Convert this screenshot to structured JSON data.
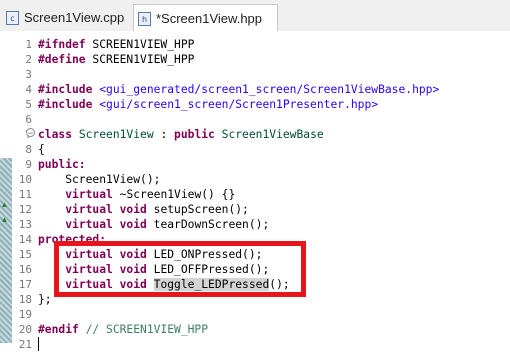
{
  "tabs": [
    {
      "label": "Screen1View.cpp",
      "icon": "cpp-file-icon",
      "icon_glyph": "c",
      "active": false
    },
    {
      "label": "*Screen1View.hpp",
      "icon": "header-file-icon",
      "icon_glyph": "h",
      "active": true
    }
  ],
  "gutter": {
    "line_numbers": [
      "1",
      "2",
      "3",
      "4",
      "5",
      "6",
      "7",
      "8",
      "9",
      "10",
      "11",
      "12",
      "13",
      "14",
      "15",
      "16",
      "17",
      "18",
      "19",
      "20",
      "21"
    ]
  },
  "code": {
    "l1a": "#ifndef ",
    "l1b": "SCREEN1VIEW_HPP",
    "l2a": "#define ",
    "l2b": "SCREEN1VIEW_HPP",
    "l4a": "#include ",
    "l4b": "<gui_generated/screen1_screen/Screen1ViewBase.hpp>",
    "l5a": "#include ",
    "l5b": "<gui/screen1_screen/Screen1Presenter.hpp>",
    "l7a": "class ",
    "l7b": "Screen1View",
    "l7c": " : ",
    "l7d": "public ",
    "l7e": "Screen1ViewBase",
    "l8": "{",
    "l9": "public:",
    "l10": "    Screen1View();",
    "l11a": "    ",
    "l11b": "virtual ",
    "l11c": "~Screen1View() {}",
    "l12a": "    ",
    "l12b": "virtual void ",
    "l12c": "setupScreen();",
    "l13a": "    ",
    "l13b": "virtual void ",
    "l13c": "tearDownScreen();",
    "l14": "protected:",
    "l15a": "    ",
    "l15b": "virtual void ",
    "l15c": "LED_ONPressed();",
    "l16a": "    ",
    "l16b": "virtual void ",
    "l16c": "LED_OFFPressed();",
    "l17a": "    ",
    "l17b": "virtual void ",
    "l17c": "Toggle_LEDPressed",
    "l17d": "();",
    "l18": "};",
    "l20a": "#endif ",
    "l20b": "// SCREEN1VIEW_HPP"
  },
  "colors": {
    "keyword": "#7f0055",
    "include_path": "#2a00ff",
    "comment": "#3f7f5f",
    "highlight_box": "#e8141c"
  }
}
